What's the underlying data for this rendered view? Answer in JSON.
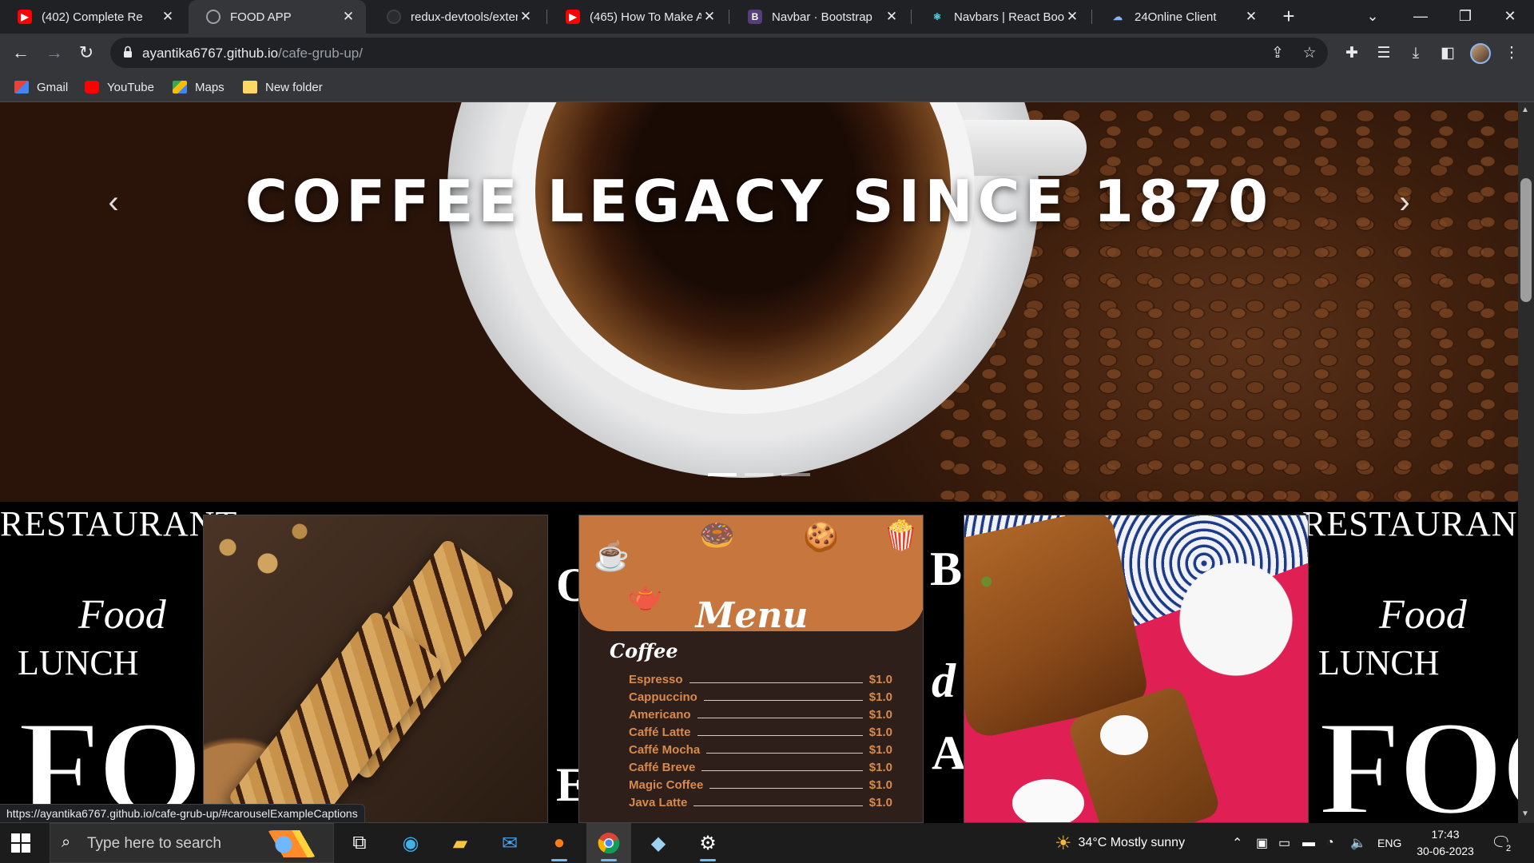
{
  "browser": {
    "tabs": [
      {
        "title": "(402) Complete Re",
        "icon": "youtube-icon"
      },
      {
        "title": "FOOD APP",
        "icon": "globe-icon",
        "active": true
      },
      {
        "title": "redux-devtools/exten",
        "icon": "github-icon"
      },
      {
        "title": "(465) How To Make A",
        "icon": "youtube-icon"
      },
      {
        "title": "Navbar · Bootstrap",
        "icon": "bootstrap-icon"
      },
      {
        "title": "Navbars | React Boots",
        "icon": "react-bootstrap-icon"
      },
      {
        "title": "24Online Client",
        "icon": "cloud-icon"
      }
    ],
    "url_host": "ayantika6767.github.io",
    "url_path": "/cafe-grub-up/",
    "bookmarks": [
      {
        "label": "Gmail",
        "icon": "gmail-icon"
      },
      {
        "label": "YouTube",
        "icon": "youtube-icon"
      },
      {
        "label": "Maps",
        "icon": "maps-icon"
      },
      {
        "label": "New folder",
        "icon": "folder-icon"
      }
    ],
    "status_url": "https://ayantika6767.github.io/cafe-grub-up/#carouselExampleCaptions"
  },
  "page": {
    "carousel": {
      "caption": "COFFEE LEGACY SINCE 1870",
      "indicator_count": 3,
      "active_indicator": 1
    },
    "background_text": {
      "restaurant": "RESTAURANT",
      "food": "Food",
      "lunch": "LUNCH",
      "big": "FOO"
    },
    "menu_card": {
      "title": "Menu",
      "section": "Coffee",
      "items": [
        {
          "name": "Espresso",
          "price": "$1.0"
        },
        {
          "name": "Cappuccino",
          "price": "$1.0"
        },
        {
          "name": "Americano",
          "price": "$1.0"
        },
        {
          "name": "Caffé Latte",
          "price": "$1.0"
        },
        {
          "name": "Caffé Mocha",
          "price": "$1.0"
        },
        {
          "name": "Caffé Breve",
          "price": "$1.0"
        },
        {
          "name": "Magic Coffee",
          "price": "$1.0"
        },
        {
          "name": "Java Latte",
          "price": "$1.0"
        }
      ]
    }
  },
  "taskbar": {
    "search_placeholder": "Type here to search",
    "weather": "34°C  Mostly sunny",
    "language": "ENG",
    "time": "17:43",
    "date": "30-06-2023",
    "notification_count": "2"
  }
}
